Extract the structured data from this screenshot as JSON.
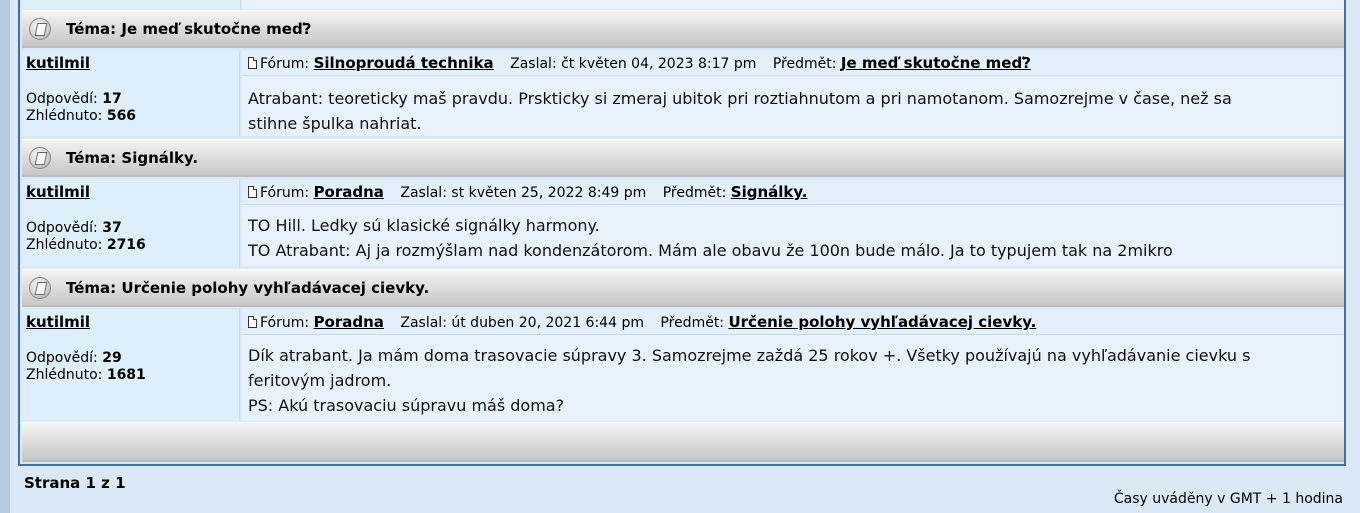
{
  "topics": [
    {
      "title": "Téma: Je meď skutočne meď?",
      "username": "kutilmil",
      "replies_label": "Odpovědí:",
      "replies": "17",
      "views_label": "Zhlédnuto:",
      "views": "566",
      "forum_label": "Fórum:",
      "forum": "Silnoproudá technika",
      "posted": "Zaslal: čt květen 04, 2023 8:17 pm",
      "subject_label": "Předmět:",
      "subject": "Je meď skutočne meď?",
      "message_lines": [
        "Atrabant: teoreticky maš pravdu. Prskticky si zmeraj ubitok pri roztiahnutom a pri namotanom. Samozrejme v čase, než sa",
        "stihne špulka nahriat."
      ]
    },
    {
      "title": "Téma: Signálky.",
      "username": "kutilmil",
      "replies_label": "Odpovědí:",
      "replies": "37",
      "views_label": "Zhlédnuto:",
      "views": "2716",
      "forum_label": "Fórum:",
      "forum": "Poradna",
      "posted": "Zaslal: st květen 25, 2022 8:49 pm",
      "subject_label": "Předmět:",
      "subject": "Signálky.",
      "message_lines": [
        "TO Hill. Ledky sú klasické signálky harmony.",
        "TO Atrabant: Aj ja rozmýšlam nad kondenzátorom. Mám ale obavu že 100n bude málo. Ja to typujem tak na 2mikro"
      ]
    },
    {
      "title": "Téma: Určenie polohy vyhľadávacej cievky.",
      "username": "kutilmil",
      "replies_label": "Odpovědí:",
      "replies": "29",
      "views_label": "Zhlédnuto:",
      "views": "1681",
      "forum_label": "Fórum:",
      "forum": "Poradna",
      "posted": "Zaslal: út duben 20, 2021 6:44 pm",
      "subject_label": "Předmět:",
      "subject": "Určenie polohy vyhľadávacej cievky.",
      "message_lines": [
        "Dík atrabant. Ja mám doma trasovacie súpravy 3. Samozrejme zaždá 25 rokov +. Všetky používajú na vyhľadávanie cievku s",
        "feritovým jadrom.",
        "PS: Akú trasovaciu súpravu máš doma?"
      ]
    }
  ],
  "footer": {
    "pagination": "Strana 1 z 1",
    "timezone": "Časy uváděny v GMT + 1 hodina"
  }
}
